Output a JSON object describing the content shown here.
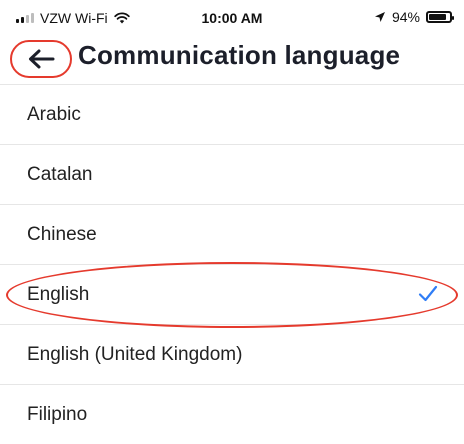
{
  "status_bar": {
    "carrier": "VZW Wi-Fi",
    "time": "10:00 AM",
    "battery_percent": "94%",
    "battery_level": 0.94,
    "icons": {
      "signal": "signal-icon",
      "wifi": "wifi-icon",
      "location": "location-arrow-icon",
      "battery": "battery-icon"
    }
  },
  "header": {
    "title": "Communication language",
    "back_icon": "arrow-left-icon"
  },
  "languages": [
    {
      "label": "Arabic",
      "selected": false
    },
    {
      "label": "Catalan",
      "selected": false
    },
    {
      "label": "Chinese",
      "selected": false
    },
    {
      "label": "English",
      "selected": true
    },
    {
      "label": "English (United Kingdom)",
      "selected": false
    },
    {
      "label": "Filipino",
      "selected": false
    }
  ],
  "colors": {
    "annotation_red": "#e53a2d",
    "check_blue": "#2f7df6",
    "title_text": "#1c1f2a",
    "divider": "#e6e6e6"
  }
}
